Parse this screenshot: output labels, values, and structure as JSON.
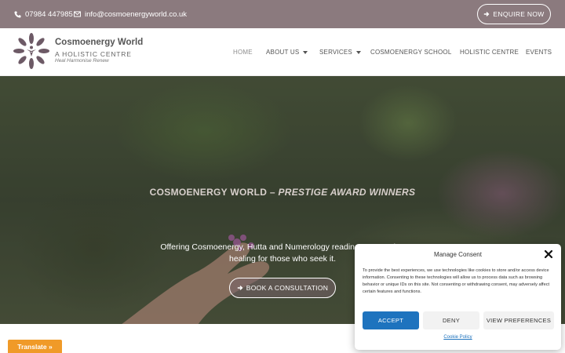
{
  "topbar": {
    "phone": "07984 447985",
    "email": "info@cosmoenergyworld.co.uk",
    "enquire_label": "ENQUIRE NOW"
  },
  "brand": {
    "name": "Cosmoenergy World",
    "subtitle": "A HOLISTIC CENTRE",
    "tagline": "Heal Harmonise Renew"
  },
  "nav": {
    "items": [
      {
        "label": "HOME"
      },
      {
        "label": "ABOUT US"
      },
      {
        "label": "SERVICES"
      },
      {
        "label": "COSMOENERGY SCHOOL"
      },
      {
        "label": "HOLISTIC CENTRE"
      },
      {
        "label": "EVENTS"
      }
    ]
  },
  "hero": {
    "title_plain": "COSMOENERGY WORLD – ",
    "title_em": "PRESTIGE AWARD WINNERS",
    "text_line1": "Offering Cosmoenergy, Hutta and Numerology readings, promoting",
    "text_line2": "healing for those who seek it.",
    "button_label": "BOOK A CONSULTATION"
  },
  "translate": {
    "label": "Translate »"
  },
  "consent": {
    "title": "Manage Consent",
    "text": "To provide the best experiences, we use technologies like cookies to store and/or access device information. Consenting to these technologies will allow us to process data such as browsing behavior or unique IDs on this site. Not consenting or withdrawing consent, may adversely affect certain features and functions.",
    "accept_label": "ACCEPT",
    "deny_label": "DENY",
    "prefs_label": "VIEW PREFERENCES",
    "policy_label": "Cookie Policy"
  },
  "colors": {
    "topbar": "#8b7a7e",
    "accent_blue": "#1e73be",
    "translate": "#f09a28"
  }
}
